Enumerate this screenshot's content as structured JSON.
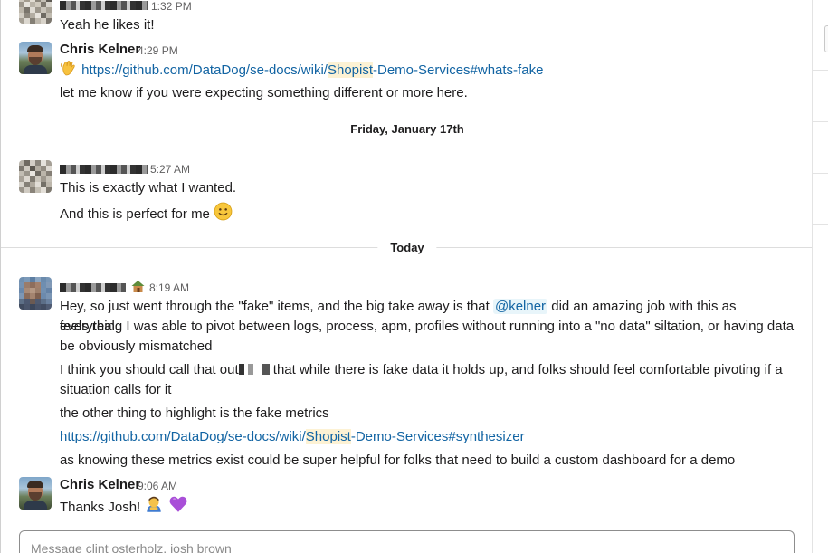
{
  "messages": [
    {
      "time": "1:32 PM",
      "lines": [
        "Yeah he likes it!"
      ]
    },
    {
      "sender": "Chris Kelner",
      "time": "4:29 PM",
      "link1": {
        "pre": "https://github.com/DataDog/se-docs/wiki/",
        "hl": "Shopist",
        "post": "-Demo-Services#whats-fake"
      },
      "line2": "let me know if you were expecting something different or more here."
    },
    {
      "day": "Friday, January 17th"
    },
    {
      "time": "5:27 AM",
      "lines": [
        "This is exactly what I wanted.",
        "And this is perfect for me"
      ]
    },
    {
      "day": "Today"
    },
    {
      "time": "8:19 AM",
      "p1a": "Hey, so just went through the \"fake\" items, and the big take away is that ",
      "mention": "@kelner",
      "p1b": " did an amazing job with this as everything",
      "p1c": "feels real.. I was able to pivot between logs, process, apm, profiles without running into a \"no data\" siltation, or having data",
      "p1d": "be obviously mismatched",
      "p2a": "I think you should call that out",
      "p2b": " that while there is fake data it holds up, and folks should feel comfortable pivoting if a",
      "p2c": "situation calls for it",
      "p3": "the other thing to highlight is the fake metrics",
      "link2": {
        "pre": "https://github.com/DataDog/se-docs/wiki/",
        "hl": "Shopist",
        "post": "-Demo-Services#synthesizer"
      },
      "p4": "as knowing these metrics exist could be super helpful for folks that need to build a custom dashboard for a demo"
    },
    {
      "sender": "Chris Kelner",
      "time": "9:06 AM",
      "text": "Thanks Josh!"
    }
  ],
  "composer": {
    "placeholder": "Message clint osterholz, josh brown"
  },
  "emoji": {
    "wave": "wave-emoji",
    "smile": "slightly-smiling-emoji",
    "hut": "house-status-emoji",
    "bow": "bowing-emoji",
    "heart": "purple-heart-emoji"
  }
}
